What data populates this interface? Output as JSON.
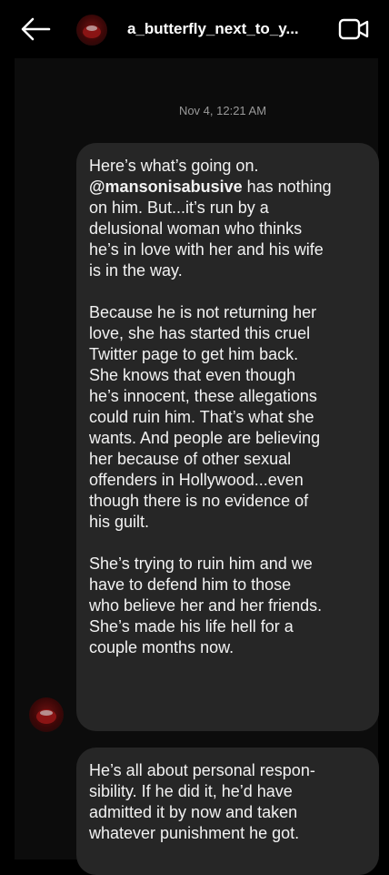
{
  "header": {
    "username": "a_butterfly_next_to_y...",
    "back_icon": "arrow-left-icon",
    "video_icon": "video-call-icon"
  },
  "thread": {
    "timestamp": "Nov 4, 12:21 AM",
    "messages": [
      {
        "paragraphs": [
          [
            "Here’s what’s going on.",
            "@mansonisabusive has nothing",
            "on him. But...it’s run by a",
            "delusional woman who thinks",
            "he’s in love with her and his wife",
            "is in the way."
          ],
          [
            "Because he is not returning her",
            "love, she has started this cruel",
            "Twitter page to get him back.",
            "She knows that even though",
            "he’s innocent, these allegations",
            "could ruin him. That’s what she",
            "wants. And people are believing",
            "her because of other sexual",
            "offenders in Hollywood...even",
            "though there is no evidence of",
            "his guilt."
          ],
          [
            "She’s trying to ruin him and we",
            "have to defend him to those",
            "who believe her and her friends.",
            "She’s made his life hell for a",
            "couple months now."
          ]
        ],
        "mention": "@mansonisabusive"
      },
      {
        "lines": [
          "He’s all about personal respon-",
          "sibility. If he did it, he’d have",
          "admitted it by now and taken",
          "whatever punishment he got."
        ]
      }
    ]
  }
}
